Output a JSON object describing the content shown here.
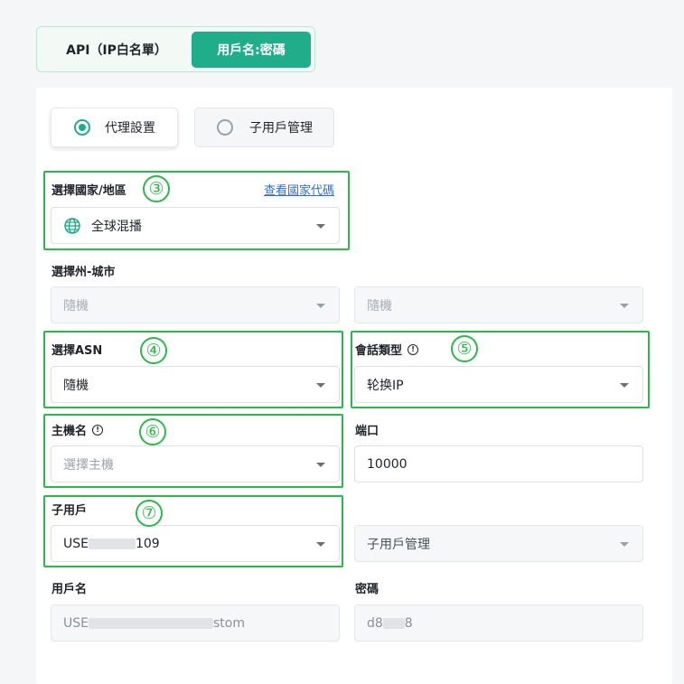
{
  "tabs": {
    "api_label": "API（IP白名單）",
    "user_label": "用戶名:密碼"
  },
  "radios": {
    "proxy_label": "代理設置",
    "subuser_label": "子用戶管理"
  },
  "country": {
    "label": "選擇國家/地區",
    "link": "查看國家代碼",
    "value": "全球混播"
  },
  "state_city": {
    "label": "選擇州-城市",
    "state_value": "隨機",
    "city_value": "隨機"
  },
  "asn": {
    "label": "選擇ASN",
    "value": "隨機"
  },
  "session": {
    "label": "會話類型",
    "value": "轮换IP"
  },
  "host": {
    "label": "主機名",
    "placeholder": "選擇主機"
  },
  "port": {
    "label": "端口",
    "value": "10000"
  },
  "subuser": {
    "label": "子用戶",
    "value_start": "USE",
    "value_end": "109",
    "manage_value": "子用戶管理"
  },
  "username": {
    "label": "用戶名",
    "value_start": "USE",
    "value_end": "stom"
  },
  "password": {
    "label": "密碼",
    "value_start": "d8",
    "value_end": "8"
  },
  "annotations": {
    "n3": "③",
    "n4": "④",
    "n5": "⑤",
    "n6": "⑥",
    "n7": "⑦"
  },
  "colors": {
    "accent": "#20ad8a",
    "highlight": "#2db84b",
    "link": "#2f6fd1"
  }
}
